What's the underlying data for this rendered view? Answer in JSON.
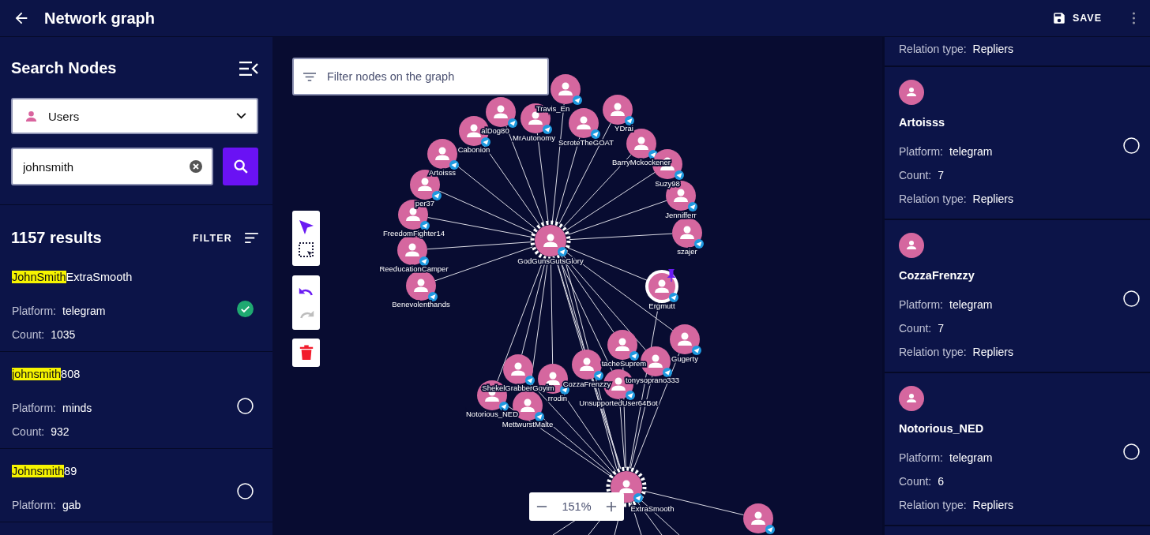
{
  "app_bar": {
    "title": "Network graph",
    "save_label": "SAVE"
  },
  "search_panel": {
    "title": "Search Nodes",
    "node_type": "Users",
    "query": "johnsmith",
    "results_count": "1157 results",
    "filter_label": "FILTER",
    "results": [
      {
        "match": "JohnSmith",
        "rest": "ExtraSmooth",
        "platform_label": "Platform:",
        "platform": "telegram",
        "count_label": "Count:",
        "count": "1035",
        "selected": true
      },
      {
        "match": "johnsmith",
        "rest": "808",
        "platform_label": "Platform:",
        "platform": "minds",
        "count_label": "Count:",
        "count": "932",
        "selected": false
      },
      {
        "match": "Johnsmith",
        "rest": "89",
        "platform_label": "Platform:",
        "platform": "gab",
        "selected": false
      }
    ]
  },
  "graph": {
    "filter": {
      "placeholder": "Filter nodes on the graph"
    },
    "tools": [
      {
        "kind": "pointer",
        "selected": true
      },
      {
        "kind": "marquee",
        "selected": false
      }
    ],
    "history": [
      {
        "kind": "undo",
        "disabled": false
      },
      {
        "kind": "redo",
        "disabled": true
      }
    ],
    "zoom": "151%",
    "nodes": [
      {
        "label": "GodGunsGutsGlory",
        "kind": "hub",
        "pinned": false
      },
      {
        "label": "alDog80",
        "kind": "user",
        "pinned": false
      },
      {
        "label": "Travis_En",
        "kind": "user",
        "pinned": false
      },
      {
        "label": "MrAutonomy",
        "kind": "user",
        "pinned": false
      },
      {
        "label": "ScroteTheGOAT",
        "kind": "user",
        "pinned": false
      },
      {
        "label": "YDrai",
        "kind": "user",
        "pinned": false
      },
      {
        "label": "BarryMckockener",
        "kind": "user",
        "pinned": false
      },
      {
        "label": "Suzy98",
        "kind": "user",
        "pinned": false
      },
      {
        "label": "Jennifferr",
        "kind": "user",
        "pinned": false
      },
      {
        "label": "szajer",
        "kind": "user",
        "pinned": false
      },
      {
        "label": "Cabonion",
        "kind": "user",
        "pinned": false
      },
      {
        "label": "Artoisss",
        "kind": "user",
        "pinned": false
      },
      {
        "label": "per37",
        "kind": "user",
        "pinned": false
      },
      {
        "label": "FreedomFighter14",
        "kind": "user",
        "pinned": false
      },
      {
        "label": "ReeducationCamper",
        "kind": "user",
        "pinned": false
      },
      {
        "label": "Benevolenthands",
        "kind": "user",
        "pinned": false
      },
      {
        "label": "Ergmutt",
        "kind": "user",
        "pinned": true
      },
      {
        "label": "Gugerty",
        "kind": "user",
        "pinned": false
      },
      {
        "label": "tacheSuprem",
        "kind": "user",
        "pinned": false
      },
      {
        "label": "tonysoprano333",
        "kind": "user",
        "pinned": false
      },
      {
        "label": "CozzaFrenzzy",
        "kind": "user",
        "pinned": false
      },
      {
        "label": "UnsupportedUser64Bot",
        "kind": "user",
        "pinned": false
      },
      {
        "label": "ShekelGrabberGoyim",
        "kind": "user",
        "pinned": false
      },
      {
        "label": "rrodin",
        "kind": "user",
        "pinned": false
      },
      {
        "label": "Notorious_NED",
        "kind": "user",
        "pinned": false
      },
      {
        "label": "MettwurstMalte",
        "kind": "user",
        "pinned": false
      },
      {
        "label": "ExtraSmooth",
        "kind": "hub",
        "pinned": false
      },
      {
        "kind": "user",
        "pinned": false
      }
    ]
  },
  "details_panel": {
    "partial_card": {
      "relation_label": "Relation type:",
      "relation": "Repliers"
    },
    "cards": [
      {
        "name": "Artoisss",
        "platform_label": "Platform:",
        "platform": "telegram",
        "count_label": "Count:",
        "count": "7",
        "relation_label": "Relation type:",
        "relation": "Repliers",
        "selected": false
      },
      {
        "name": "CozzaFrenzzy",
        "platform_label": "Platform:",
        "platform": "telegram",
        "count_label": "Count:",
        "count": "7",
        "relation_label": "Relation type:",
        "relation": "Repliers",
        "selected": false
      },
      {
        "name": "Notorious_NED",
        "platform_label": "Platform:",
        "platform": "telegram",
        "count_label": "Count:",
        "count": "6",
        "relation_label": "Relation type:",
        "relation": "Repliers",
        "selected": false
      }
    ]
  }
}
